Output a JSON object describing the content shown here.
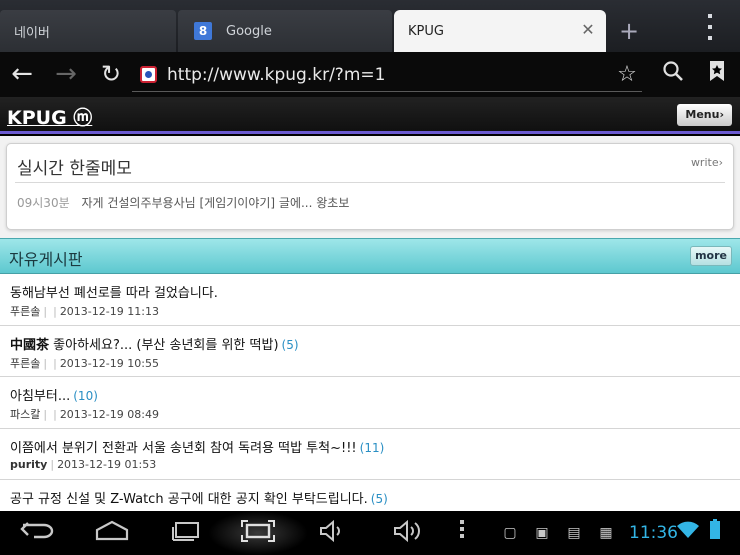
{
  "tabs": [
    {
      "label": "네이버"
    },
    {
      "label": "Google"
    },
    {
      "label": "KPUG"
    }
  ],
  "url": "http://www.kpug.kr/?m=1",
  "site": {
    "logo": "KPUG ⓜ",
    "menu_label": "Menu›"
  },
  "memo": {
    "title": "실시간 한줄메모",
    "write_label": "write›",
    "entry_time": "09시30분",
    "entry_text": "자게 건설의주부용사님 [게임기이야기] 글에... 왕초보"
  },
  "board": {
    "title": "자유게시판",
    "more_label": "more",
    "posts": [
      {
        "title": "동해남부선 폐선로를 따라 걸었습니다.",
        "bold_prefix": "",
        "count": "",
        "author": "푸른솔",
        "date": "2013-12-19 11:13"
      },
      {
        "title": " 좋아하세요?... (부산 송년회를 위한 떡밥)",
        "bold_prefix": "中國茶",
        "count": "(5)",
        "author": "푸른솔",
        "date": "2013-12-19 10:55"
      },
      {
        "title": "아침부터...",
        "bold_prefix": "",
        "count": "(10)",
        "author": "파스칼",
        "date": "2013-12-19 08:49"
      },
      {
        "title": "이쯤에서 분위기 전환과 서울 송년회 참여 독려용 떡밥 투척~!!!",
        "bold_prefix": "",
        "count": "(11)",
        "author": "purity",
        "date": "2013-12-19 01:53"
      },
      {
        "title": "공구 규정 신설 및 Z-Watch 공구에 대한 공지 확인 부탁드립니다.",
        "bold_prefix": "",
        "count": "(5)",
        "author": "",
        "date": ""
      }
    ]
  },
  "system": {
    "clock": "11:36"
  },
  "colors": {
    "accent_purple": "#6b5ad0",
    "board_header": "#5dc8cf",
    "count_link": "#2a8fc4",
    "clock": "#33b5e5"
  }
}
